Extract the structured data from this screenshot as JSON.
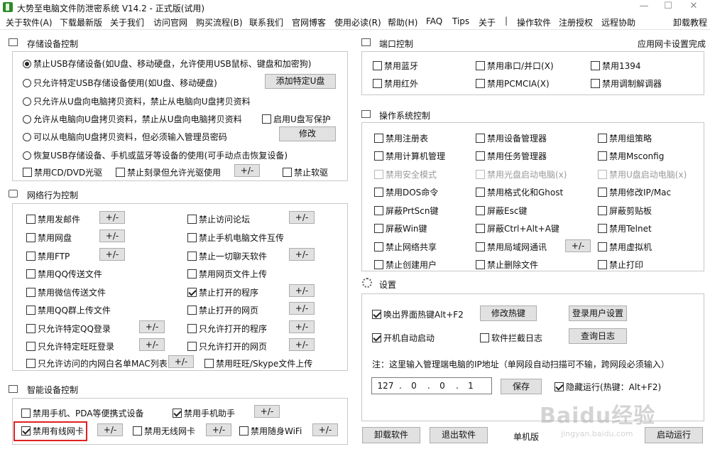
{
  "window": {
    "title": "大势至电脑文件防泄密系统 V14.2 - 正式版(试用)",
    "minimize": "—",
    "maximize": "☐",
    "close": "✕"
  },
  "menu": [
    "关于软件(A)",
    "下载最新版",
    "关于我们",
    "访问官网",
    "购买流程(B)",
    "联系我们",
    "官网博客",
    "使用必读(R)",
    "帮助(H)",
    "FAQ",
    "Tips",
    "关于",
    "|",
    "操作软件",
    "注册授权",
    "远程协助",
    "卸载教程"
  ],
  "storage": {
    "title": "存储设备控制",
    "radios": [
      {
        "label": "禁止USB存储设备(如U盘、移动硬盘，允许使用USB鼠标、键盘和加密狗)",
        "checked": true
      },
      {
        "label": "只允许特定USB存储设备使用(如U盘、移动硬盘)",
        "checked": false
      },
      {
        "label": "只允许从U盘向电脑拷贝资料，禁止从电脑向U盘拷贝资料",
        "checked": false
      },
      {
        "label": "允许从电脑向U盘拷贝资料，禁止从U盘向电脑拷贝资料",
        "checked": false
      },
      {
        "label": "可以从电脑向U盘拷贝资料，但必须输入管理员密码",
        "checked": false
      },
      {
        "label": "恢复USB存储设备、手机或蓝牙等设备的使用(可手动点击恢复设备)",
        "checked": false
      }
    ],
    "add_udisk_button": "添加特定U盘",
    "udisk_write_protect": "启用U盘写保护",
    "modify_button": "修改",
    "disable_cd": "禁用CD/DVD光驱",
    "disable_burn": "禁止刻录但允许光驱使用",
    "disable_floppy": "禁止软驱",
    "pm": "+/-"
  },
  "network": {
    "title": "网络行为控制",
    "left": [
      {
        "label": "禁用发邮件",
        "checked": false,
        "pm": true
      },
      {
        "label": "禁用网盘",
        "checked": false,
        "pm": true
      },
      {
        "label": "禁用FTP",
        "checked": false,
        "pm": true
      },
      {
        "label": "禁用QQ传送文件",
        "checked": false,
        "pm": false
      },
      {
        "label": "禁用微信传送文件",
        "checked": false,
        "pm": false
      },
      {
        "label": "禁用QQ群上传文件",
        "checked": false,
        "pm": false
      },
      {
        "label": "只允许特定QQ登录",
        "checked": false,
        "pm": true
      },
      {
        "label": "只允许特定旺旺登录",
        "checked": false,
        "pm": true
      },
      {
        "label": "只允许访问的内网白名单MAC列表",
        "checked": false,
        "pm": true
      }
    ],
    "right": [
      {
        "label": "禁止访问论坛",
        "checked": false,
        "pm": true
      },
      {
        "label": "禁止手机电脑文件互传",
        "checked": false,
        "pm": false
      },
      {
        "label": "禁止一切聊天软件",
        "checked": false,
        "pm": true
      },
      {
        "label": "禁用网页文件上传",
        "checked": false,
        "pm": false
      },
      {
        "label": "禁止打开的程序",
        "checked": true,
        "pm": true
      },
      {
        "label": "禁止打开的网页",
        "checked": false,
        "pm": true
      },
      {
        "label": "只允许打开的程序",
        "checked": false,
        "pm": true
      },
      {
        "label": "只允许打开的网页",
        "checked": false,
        "pm": true
      },
      {
        "label": "禁用旺旺/Skype文件上传",
        "checked": false,
        "pm": false
      }
    ]
  },
  "smart": {
    "title": "智能设备控制",
    "items": [
      {
        "label": "禁用手机、PDA等便携式设备",
        "checked": false,
        "pm": false
      },
      {
        "label": "禁用手机助手",
        "checked": true,
        "pm": true
      },
      {
        "label": "禁用有线网卡",
        "checked": true,
        "pm": true
      },
      {
        "label": "禁用无线网卡",
        "checked": false,
        "pm": true
      },
      {
        "label": "禁用随身WiFi",
        "checked": false,
        "pm": true
      }
    ]
  },
  "port": {
    "title": "端口控制",
    "nic_status": "应用网卡设置完成",
    "items": [
      "禁用蓝牙",
      "禁用串口/并口(X)",
      "禁用1394",
      "禁用红外",
      "禁用PCMCIA(X)",
      "禁用调制解调器"
    ]
  },
  "os": {
    "title": "操作系统控制",
    "items": [
      {
        "label": "禁用注册表",
        "disabled": false
      },
      {
        "label": "禁用设备管理器",
        "disabled": false
      },
      {
        "label": "禁用组策略",
        "disabled": false
      },
      {
        "label": "禁用计算机管理",
        "disabled": false
      },
      {
        "label": "禁用任务管理器",
        "disabled": false
      },
      {
        "label": "禁用Msconfig",
        "disabled": false
      },
      {
        "label": "禁用安全模式",
        "disabled": true
      },
      {
        "label": "禁用光盘启动电脑(x)",
        "disabled": true
      },
      {
        "label": "禁用U盘启动电脑(x)",
        "disabled": true
      },
      {
        "label": "禁用DOS命令",
        "disabled": false
      },
      {
        "label": "禁用格式化和Ghost",
        "disabled": false
      },
      {
        "label": "禁用修改IP/Mac",
        "disabled": false
      },
      {
        "label": "屏蔽PrtScn键",
        "disabled": false
      },
      {
        "label": "屏蔽Esc键",
        "disabled": false
      },
      {
        "label": "屏蔽剪贴板",
        "disabled": false
      },
      {
        "label": "屏蔽Win键",
        "disabled": false
      },
      {
        "label": "屏蔽Ctrl+Alt+A键",
        "disabled": false
      },
      {
        "label": "禁用Telnet",
        "disabled": false
      },
      {
        "label": "禁止网络共享",
        "disabled": false
      },
      {
        "label": "禁用局域网通讯",
        "disabled": false
      },
      {
        "label": "禁用虚拟机",
        "disabled": false
      },
      {
        "label": "禁止创建用户",
        "disabled": false
      },
      {
        "label": "禁止删除文件",
        "disabled": false
      },
      {
        "label": "禁止打印",
        "disabled": false
      }
    ],
    "pm": "+/-"
  },
  "settings": {
    "title": "设置",
    "hotkey": "唤出界面热键Alt+F2",
    "modify_hotkey": "修改热键",
    "login_user": "登录用户设置",
    "autostart": "开机自动启动",
    "intercept_log": "软件拦截日志",
    "query_log": "查询日志",
    "note": "注：这里输入管理端电脑的IP地址（单网段自动扫描可不输，跨网段必须输入）",
    "ip": [
      "127",
      "0",
      "0",
      "1"
    ],
    "save": "保存",
    "hidden_run": "隐藏运行(热键：Alt+F2)"
  },
  "bottom": {
    "uninstall": "卸载软件",
    "exit": "退出软件",
    "mode": "单机版",
    "start": "启动运行"
  },
  "watermark": {
    "main": "Baidu经验",
    "sub": "jingyan.baidu.com"
  }
}
